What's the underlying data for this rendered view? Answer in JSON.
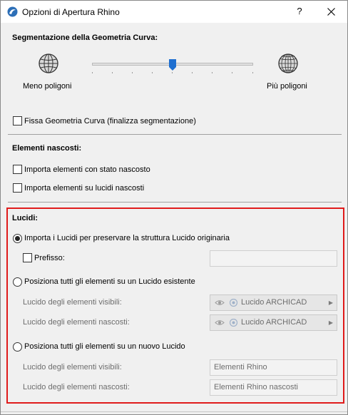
{
  "window": {
    "title": "Opzioni di Apertura Rhino",
    "help_label": "?",
    "close_label": "✕"
  },
  "segmentation": {
    "heading": "Segmentazione della Geometria Curva:",
    "less_label": "Meno poligoni",
    "more_label": "Più poligoni",
    "slider_value_fraction": 0.5,
    "fix_geometry_label": "Fissa Geometria Curva (finalizza segmentazione)",
    "fix_geometry_checked": false
  },
  "hidden": {
    "heading": "Elementi nascosti:",
    "import_hidden_state_label": "Importa elementi con stato nascosto",
    "import_hidden_state_checked": false,
    "import_hidden_layers_label": "Importa elementi su lucidi nascosti",
    "import_hidden_layers_checked": false
  },
  "layers": {
    "heading": "Lucidi:",
    "option_import_label": "Importa i Lucidi per preservare la struttura Lucido originaria",
    "option_import_selected": true,
    "prefix_label": "Prefisso:",
    "prefix_checked": false,
    "prefix_value": "",
    "option_existing_label": "Posiziona tutti gli elementi su un Lucido esistente",
    "option_existing_selected": false,
    "existing_visible_label": "Lucido degli elementi visibili:",
    "existing_visible_value": "Lucido ARCHICAD",
    "existing_hidden_label": "Lucido degli elementi nascosti:",
    "existing_hidden_value": "Lucido ARCHICAD",
    "option_new_label": "Posiziona tutti gli elementi su un nuovo Lucido",
    "option_new_selected": false,
    "new_visible_label": "Lucido degli elementi visibili:",
    "new_visible_value": "Elementi Rhino",
    "new_hidden_label": "Lucido degli elementi nascosti:",
    "new_hidden_value": "Elementi Rhino nascosti"
  },
  "colors": {
    "highlight": "#e01b1b",
    "accent_thumb": "#1e6fd0"
  }
}
